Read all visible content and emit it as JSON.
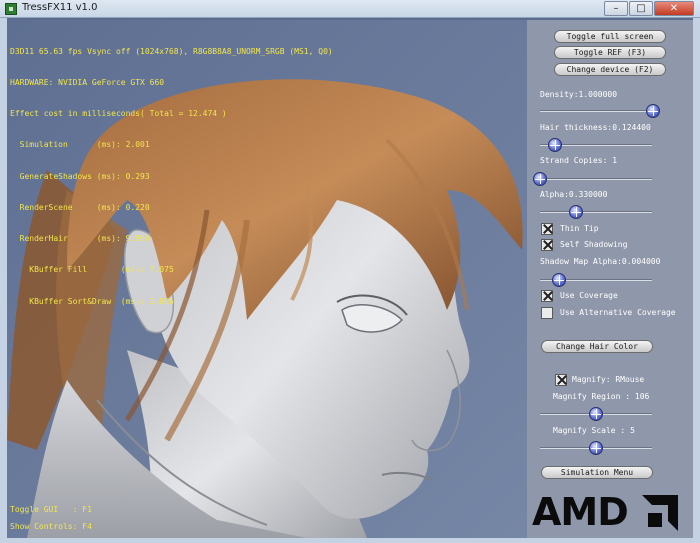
{
  "window": {
    "title": "TressFX11 v1.0",
    "minimize_glyph": "–",
    "maximize_glyph": "□",
    "close_glyph": "✕"
  },
  "hud": {
    "lines": [
      "D3D11 65.63 fps Vsync off (1024x768), R8G8B8A8_UNORM_SRGB (MS1, Q0)",
      "HARDWARE: NVIDIA GeForce GTX 660",
      "Effect cost in milliseconds( Total = 12.474 )",
      "  Simulation      (ms): 2.001",
      "  GenerateShadows (ms): 0.293",
      "  RenderScene     (ms): 0.220",
      "  RenderHair      (ms): 9.960",
      "    KBuffer Fill       (ms): 7.075",
      "    KBuffer Sort&Draw  (ms): 2.886"
    ],
    "bottom_lines": [
      "Toggle GUI   : F1",
      "Show Controls: F4"
    ]
  },
  "panel": {
    "buttons": {
      "toggle_fullscreen": "Toggle full screen",
      "toggle_ref": "Toggle REF (F3)",
      "change_device": "Change device (F2)",
      "change_hair_color": "Change Hair Color",
      "simulation_menu": "Simulation Menu"
    },
    "density_label": "Density:1.000000",
    "density_value": 1.0,
    "hair_thickness_label": "Hair thickness:0.124400",
    "hair_thickness_value": 0.08,
    "strand_copies_label": "Strand Copies: 1",
    "strand_copies_value": 0.0,
    "alpha_label": "Alpha:0.330000",
    "alpha_value": 0.3,
    "thin_tip_label": "Thin Tip",
    "self_shadowing_label": "Self Shadowing",
    "shadow_map_alpha_label": "Shadow Map Alpha:0.004000",
    "shadow_map_alpha_value": 0.12,
    "use_coverage_label": "Use Coverage",
    "use_alt_coverage_label": "Use Alternative Coverage",
    "magnify_label": "Magnify: RMouse",
    "magnify_region_label": "Magnify Region : 106",
    "magnify_region_value": 0.5,
    "magnify_scale_label": "Magnify Scale : 5",
    "magnify_scale_value": 0.5
  },
  "logo": {
    "text": "AMD"
  }
}
